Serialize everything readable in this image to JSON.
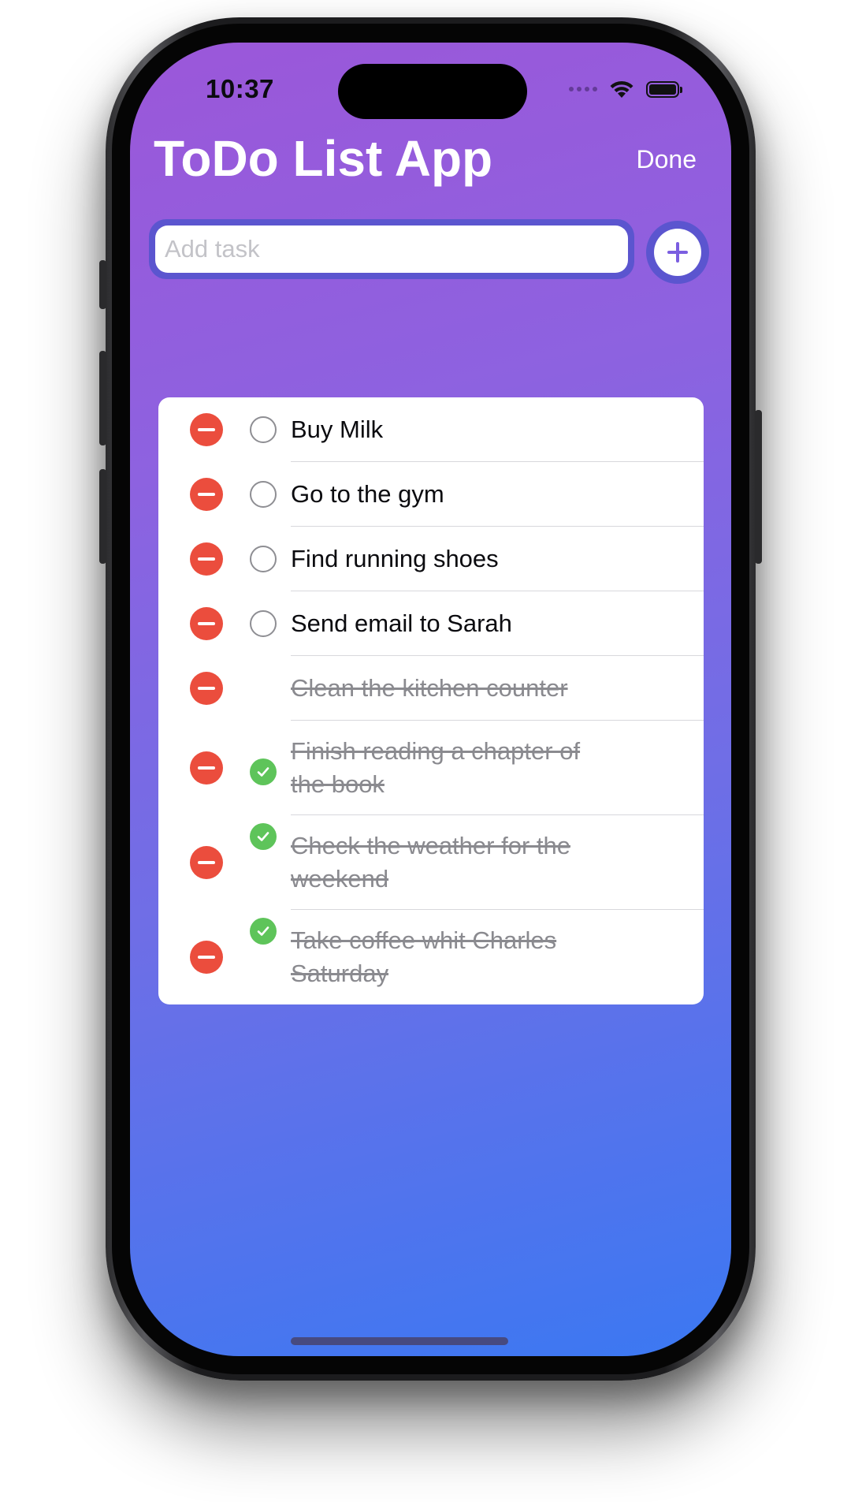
{
  "status_bar": {
    "time": "10:37"
  },
  "header": {
    "title": "ToDo List App",
    "done_label": "Done"
  },
  "add_task": {
    "placeholder": "Add task",
    "value": ""
  },
  "colors": {
    "accent": "#5b55cf",
    "delete": "#eb4d3d",
    "completed_check": "#5ec45a",
    "gradient_top": "#9b57d9",
    "gradient_bottom": "#3b78f2"
  },
  "tasks": [
    {
      "text": "Buy Milk",
      "completed": false
    },
    {
      "text": "Go to the gym",
      "completed": false
    },
    {
      "text": "Find running shoes",
      "completed": false
    },
    {
      "text": "Send email to Sarah",
      "completed": false
    },
    {
      "text": "Clean the kitchen counter",
      "completed": true
    },
    {
      "text": "Finish reading a chapter of the book",
      "completed": true
    },
    {
      "text": "Check the weather for the weekend",
      "completed": true
    },
    {
      "text": "Take coffee whit Charles Saturday",
      "completed": true
    }
  ]
}
